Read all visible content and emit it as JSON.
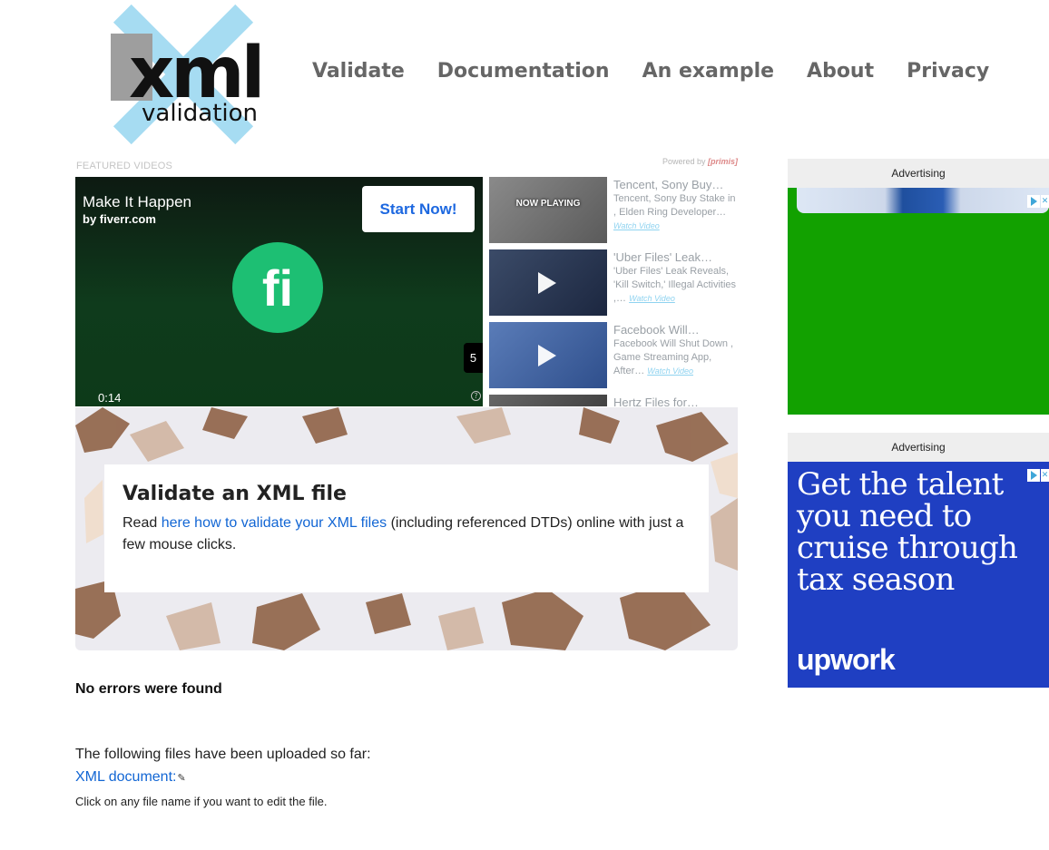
{
  "header": {
    "logo_text": "xml",
    "logo_subtext": "validation",
    "nav": [
      "Validate",
      "Documentation",
      "An example",
      "About",
      "Privacy"
    ]
  },
  "video_widget": {
    "label": "FEATURED VIDEOS",
    "powered_by": "Powered by",
    "powered_brand": "primis",
    "player": {
      "title": "Make It Happen",
      "subtitle": "by fiverr.com",
      "cta": "Start Now!",
      "logo_letter": "fi",
      "time": "0:14",
      "skip_count": "5",
      "help": "?"
    },
    "playlist": [
      {
        "title": "Tencent, Sony Buy…",
        "desc": "Tencent, Sony Buy Stake in , Elden Ring Developer…",
        "link": "Watch Video",
        "now_playing": "NOW PLAYING",
        "thumb_color": "#6b6b6b"
      },
      {
        "title": "'Uber Files' Leak…",
        "desc": "'Uber Files' Leak Reveals, 'Kill Switch,' Illegal Activities ,…",
        "link": "Watch Video",
        "now_playing": "",
        "thumb_color": "#2d3b55"
      },
      {
        "title": "Facebook Will…",
        "desc": "Facebook Will Shut Down , Game Streaming App, After…",
        "link": "Watch Video",
        "now_playing": "",
        "thumb_color": "#3d5e9a"
      },
      {
        "title": "Hertz Files for…",
        "desc": "",
        "link": "",
        "now_playing": "",
        "thumb_color": "#4a4a4a"
      }
    ]
  },
  "hero": {
    "heading": "Validate an XML file",
    "text_before": "Read ",
    "link": "here how to validate your XML files",
    "text_after": " (including referenced DTDs) online with just a few mouse clicks."
  },
  "result": {
    "status": "No errors were found",
    "uploaded_label": "The following files have been uploaded so far:",
    "file_link": "XML document:",
    "hint": "Click on any file name if you want to edit the file."
  },
  "ads": {
    "label": "Advertising",
    "ad2_headline": "Get the talent you need to cruise through tax season",
    "ad2_brand": "upwork",
    "colors": {
      "ad1": "#12a100",
      "ad2": "#1f3fc2"
    }
  }
}
